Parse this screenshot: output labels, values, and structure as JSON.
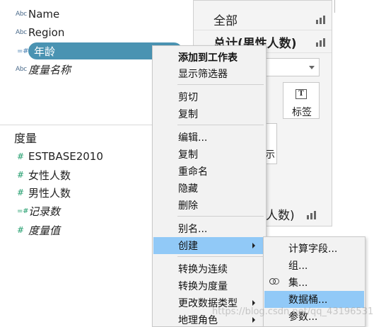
{
  "data_pane": {
    "dimensions": [
      {
        "icon": "Abc",
        "name": "Name",
        "italic": false
      },
      {
        "icon": "Abc",
        "name": "Region",
        "italic": false
      },
      {
        "icon": "=#",
        "name": "年龄",
        "italic": false,
        "selected": true
      },
      {
        "icon": "Abc",
        "name": "度量名称",
        "italic": true
      }
    ],
    "measures_header": "度量",
    "measures": [
      {
        "icon": "#",
        "name": "ESTBASE2010",
        "italic": false
      },
      {
        "icon": "#",
        "name": "女性人数",
        "italic": false
      },
      {
        "icon": "#",
        "name": "男性人数",
        "italic": false
      },
      {
        "icon": "=#",
        "name": "记录数",
        "italic": true
      },
      {
        "icon": "#",
        "name": "度量值",
        "italic": true
      }
    ]
  },
  "filters_pane": {
    "row_all": "全部",
    "row_total": "总计(男性人数)",
    "label_button": "标签",
    "label_icon_glyph": "T",
    "partial_text": "示",
    "bottom_partial": "人数)"
  },
  "context_menu": {
    "items": [
      {
        "label": "添加到工作表",
        "bold": true
      },
      {
        "label": "显示筛选器"
      },
      {
        "label": "剪切"
      },
      {
        "label": "复制"
      },
      {
        "label": "编辑..."
      },
      {
        "label": "复制"
      },
      {
        "label": "重命名"
      },
      {
        "label": "隐藏"
      },
      {
        "label": "删除"
      },
      {
        "label": "别名..."
      },
      {
        "label": "创建",
        "highlighted": true,
        "submenu": true
      },
      {
        "label": "转换为连续"
      },
      {
        "label": "转换为度量"
      },
      {
        "label": "更改数据类型",
        "submenu": true
      },
      {
        "label": "地理角色",
        "submenu": true
      }
    ]
  },
  "create_submenu": {
    "items": [
      {
        "label": "计算字段..."
      },
      {
        "label": "组..."
      },
      {
        "label": "集...",
        "icon": "set-icon"
      },
      {
        "label": "数据桶...",
        "highlighted": true
      },
      {
        "label": "参数..."
      }
    ]
  },
  "watermark": "https://blog.csdn.net/qq_43196531",
  "colors": {
    "selection_pill": "#4a93b2",
    "menu_highlight": "#91c9f7",
    "menu_bg": "#f2f2f2",
    "measure_icon": "#1f9c6b"
  }
}
